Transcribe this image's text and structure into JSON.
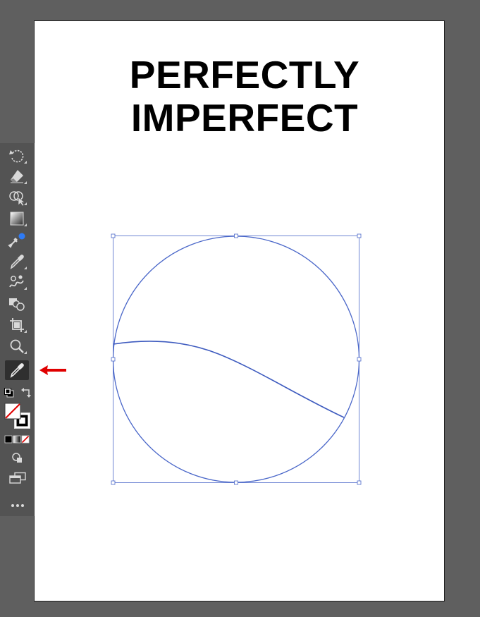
{
  "document": {
    "headline_line1": "PERFECTLY",
    "headline_line2": "IMPERFECT"
  },
  "colors": {
    "pasteboard": "#5f5f5f",
    "artboard": "#ffffff",
    "selection": "#4a67c9",
    "toolbar": "#535353",
    "annotation_arrow": "#e00000",
    "tool_active_indicator": "#2e7bf6"
  },
  "toolbar": {
    "tools": [
      {
        "id": "rotate",
        "icon": "rotate-icon"
      },
      {
        "id": "eraser",
        "icon": "eraser-icon"
      },
      {
        "id": "shape-builder",
        "icon": "shape-builder-icon"
      },
      {
        "id": "gradient",
        "icon": "gradient-icon"
      },
      {
        "id": "recolor",
        "icon": "recolor-icon"
      },
      {
        "id": "eyedropper",
        "icon": "eyedropper-icon"
      },
      {
        "id": "blend",
        "icon": "blend-icon"
      },
      {
        "id": "shapes",
        "icon": "shapes-icon"
      },
      {
        "id": "artboard",
        "icon": "artboard-icon"
      },
      {
        "id": "zoom",
        "icon": "zoom-icon"
      },
      {
        "id": "eyedropper-selected",
        "icon": "eyedropper-icon",
        "selected": true
      }
    ],
    "fill": "none",
    "stroke": "black",
    "more_tools": "more-icon"
  },
  "annotation": {
    "icon": "red-arrow-icon",
    "points_to": "eyedropper-selected"
  }
}
